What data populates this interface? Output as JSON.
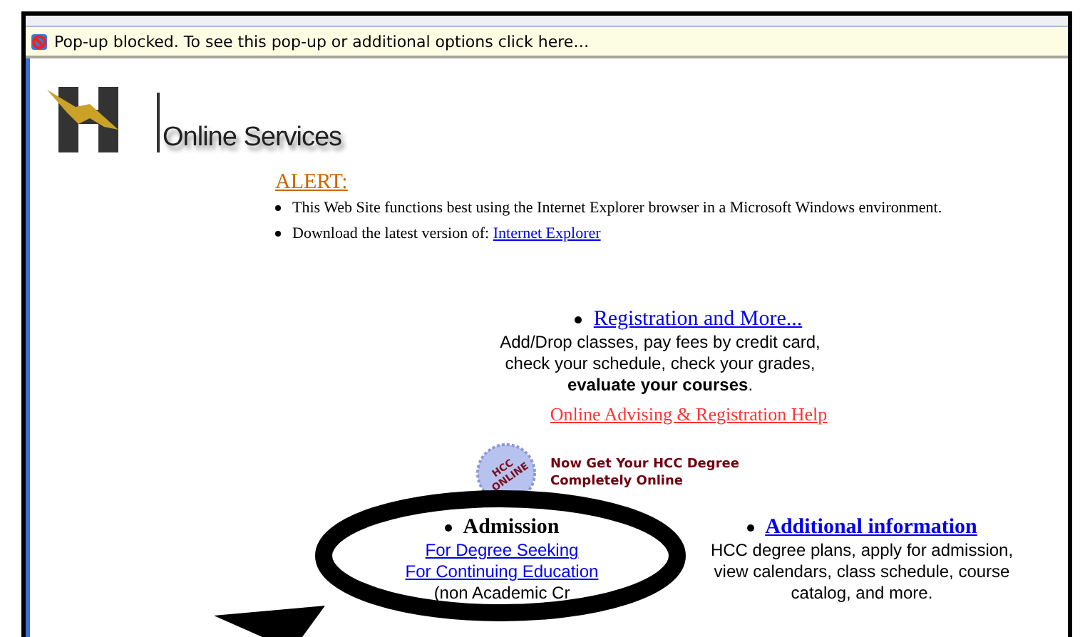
{
  "popup_bar": {
    "text": "Pop-up blocked. To see this pop-up or additional options click here…"
  },
  "header": {
    "title": "Online Services"
  },
  "alert": {
    "heading": "ALERT:",
    "items": [
      {
        "text": "This Web Site functions best using the Internet Explorer browser in a Microsoft Windows environment."
      },
      {
        "text": "Download the latest version of: ",
        "link": "Internet Explorer"
      }
    ]
  },
  "registration": {
    "link": "Registration and More...",
    "description": "Add/Drop classes, pay fees by credit card, check your schedule, check your grades, **evaluate your courses**.",
    "help_link": "Online Advising & Registration Help"
  },
  "promo": {
    "badge": "HCC ONLINE",
    "text": "Now Get Your HCC Degree Completely Online"
  },
  "admission": {
    "heading": "Admission",
    "links": [
      "For Degree Seeking",
      "For Continuing Education"
    ],
    "note": "(non Academic Cr"
  },
  "additional": {
    "link": "Additional information",
    "description": "HCC degree plans, apply for admission, view calendars, class schedule, course catalog, and more."
  }
}
